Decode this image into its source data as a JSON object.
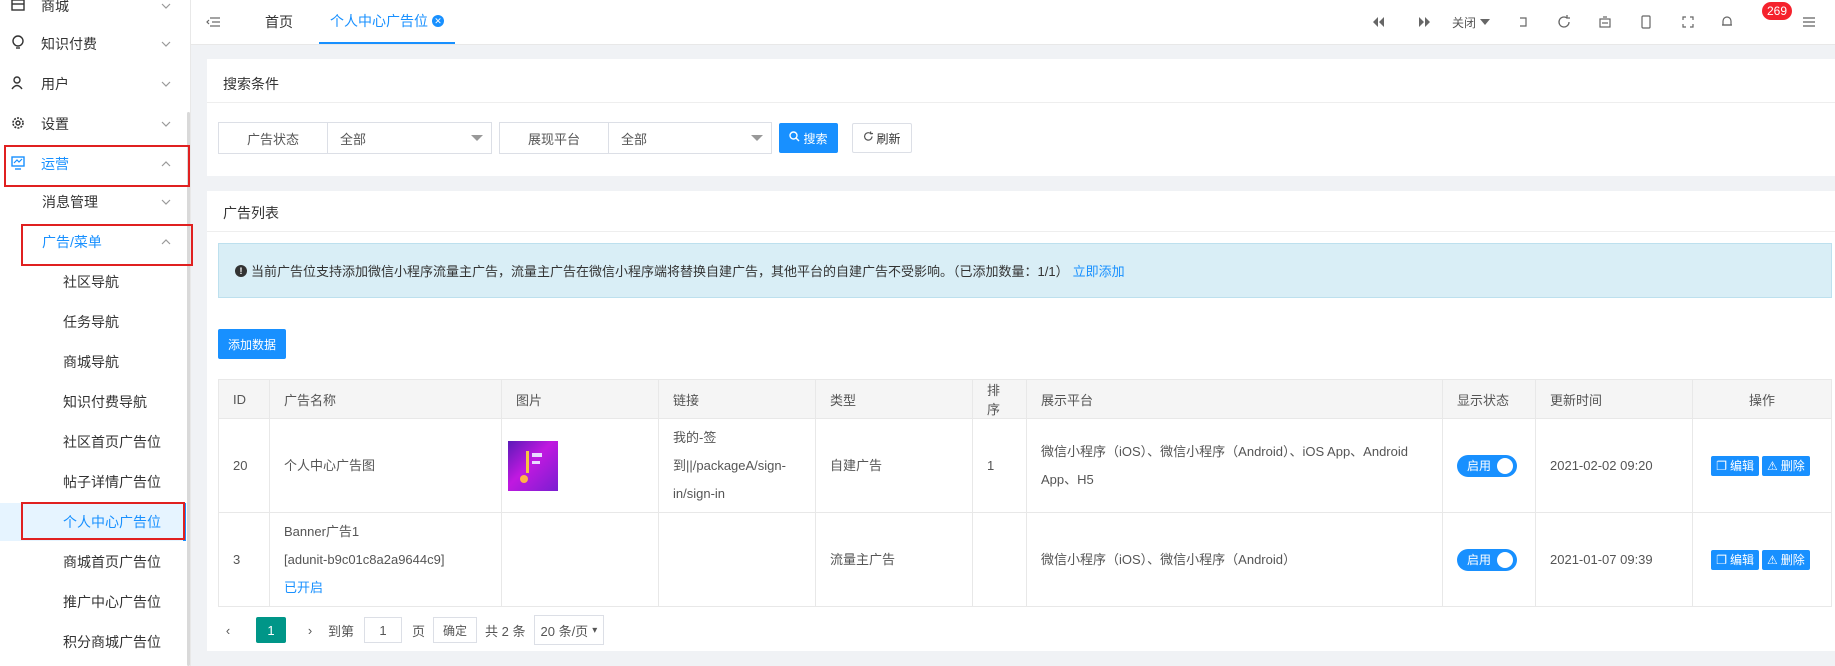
{
  "sidebar": {
    "top_items": [
      {
        "label": "商城",
        "icon": "shop-icon"
      },
      {
        "label": "知识付费",
        "icon": "bulb-icon"
      },
      {
        "label": "用户",
        "icon": "user-icon"
      },
      {
        "label": "设置",
        "icon": "gear-icon"
      },
      {
        "label": "运营",
        "icon": "monitor-icon"
      }
    ],
    "sub_items": [
      "消息管理",
      "广告/菜单"
    ],
    "leaf_items": [
      "社区导航",
      "任务导航",
      "商城导航",
      "知识付费导航",
      "社区首页广告位",
      "帖子详情广告位",
      "个人中心广告位",
      "商城首页广告位",
      "推广中心广告位",
      "积分商城广告位"
    ]
  },
  "topbar": {
    "tab_home": "首页",
    "tab_active": "个人中心广告位",
    "close_label": "关闭",
    "badge_count": "269"
  },
  "search": {
    "title": "搜索条件",
    "status_label": "广告状态",
    "status_value": "全部",
    "platform_label": "展现平台",
    "platform_value": "全部",
    "search_btn": "搜索",
    "refresh_btn": "刷新"
  },
  "list": {
    "title": "广告列表",
    "notice": "当前广告位支持添加微信小程序流量主广告，流量主广告在微信小程序端将替换自建广告，其他平台的自建广告不受影响。（已添加数量：1/1）",
    "notice_link": "立即添加",
    "add_btn": "添加数据",
    "columns": [
      "ID",
      "广告名称",
      "图片",
      "链接",
      "类型",
      "排序",
      "展示平台",
      "显示状态",
      "更新时间",
      "操作"
    ],
    "rows": [
      {
        "id": "20",
        "name": "个人中心广告图",
        "name2": "",
        "name3": "",
        "link": "我的-签到||/packageA/sign-in/sign-in",
        "type": "自建广告",
        "sort": "1",
        "platform": "微信小程序（iOS）、微信小程序（Android）、iOS App、Android App、H5",
        "status": "启用",
        "time": "2021-02-02 09:20",
        "edit": "编辑",
        "del": "删除"
      },
      {
        "id": "3",
        "name": "Banner广告1",
        "name2": "[adunit-b9c01c8a2a9644c9]",
        "name3": "已开启",
        "link": "",
        "type": "流量主广告",
        "sort": "",
        "platform": "微信小程序（iOS）、微信小程序（Android）",
        "status": "启用",
        "time": "2021-01-07 09:39",
        "edit": "编辑",
        "del": "删除"
      }
    ]
  },
  "pager": {
    "current": "1",
    "goto_label": "到第",
    "goto_value": "1",
    "page_unit": "页",
    "confirm": "确定",
    "total": "共 2 条",
    "page_size": "20 条/页"
  },
  "colors": {
    "accent": "#1890ff",
    "highlight": "#e02020",
    "notice_bg": "#d9eef6",
    "pager_active": "#009688"
  }
}
